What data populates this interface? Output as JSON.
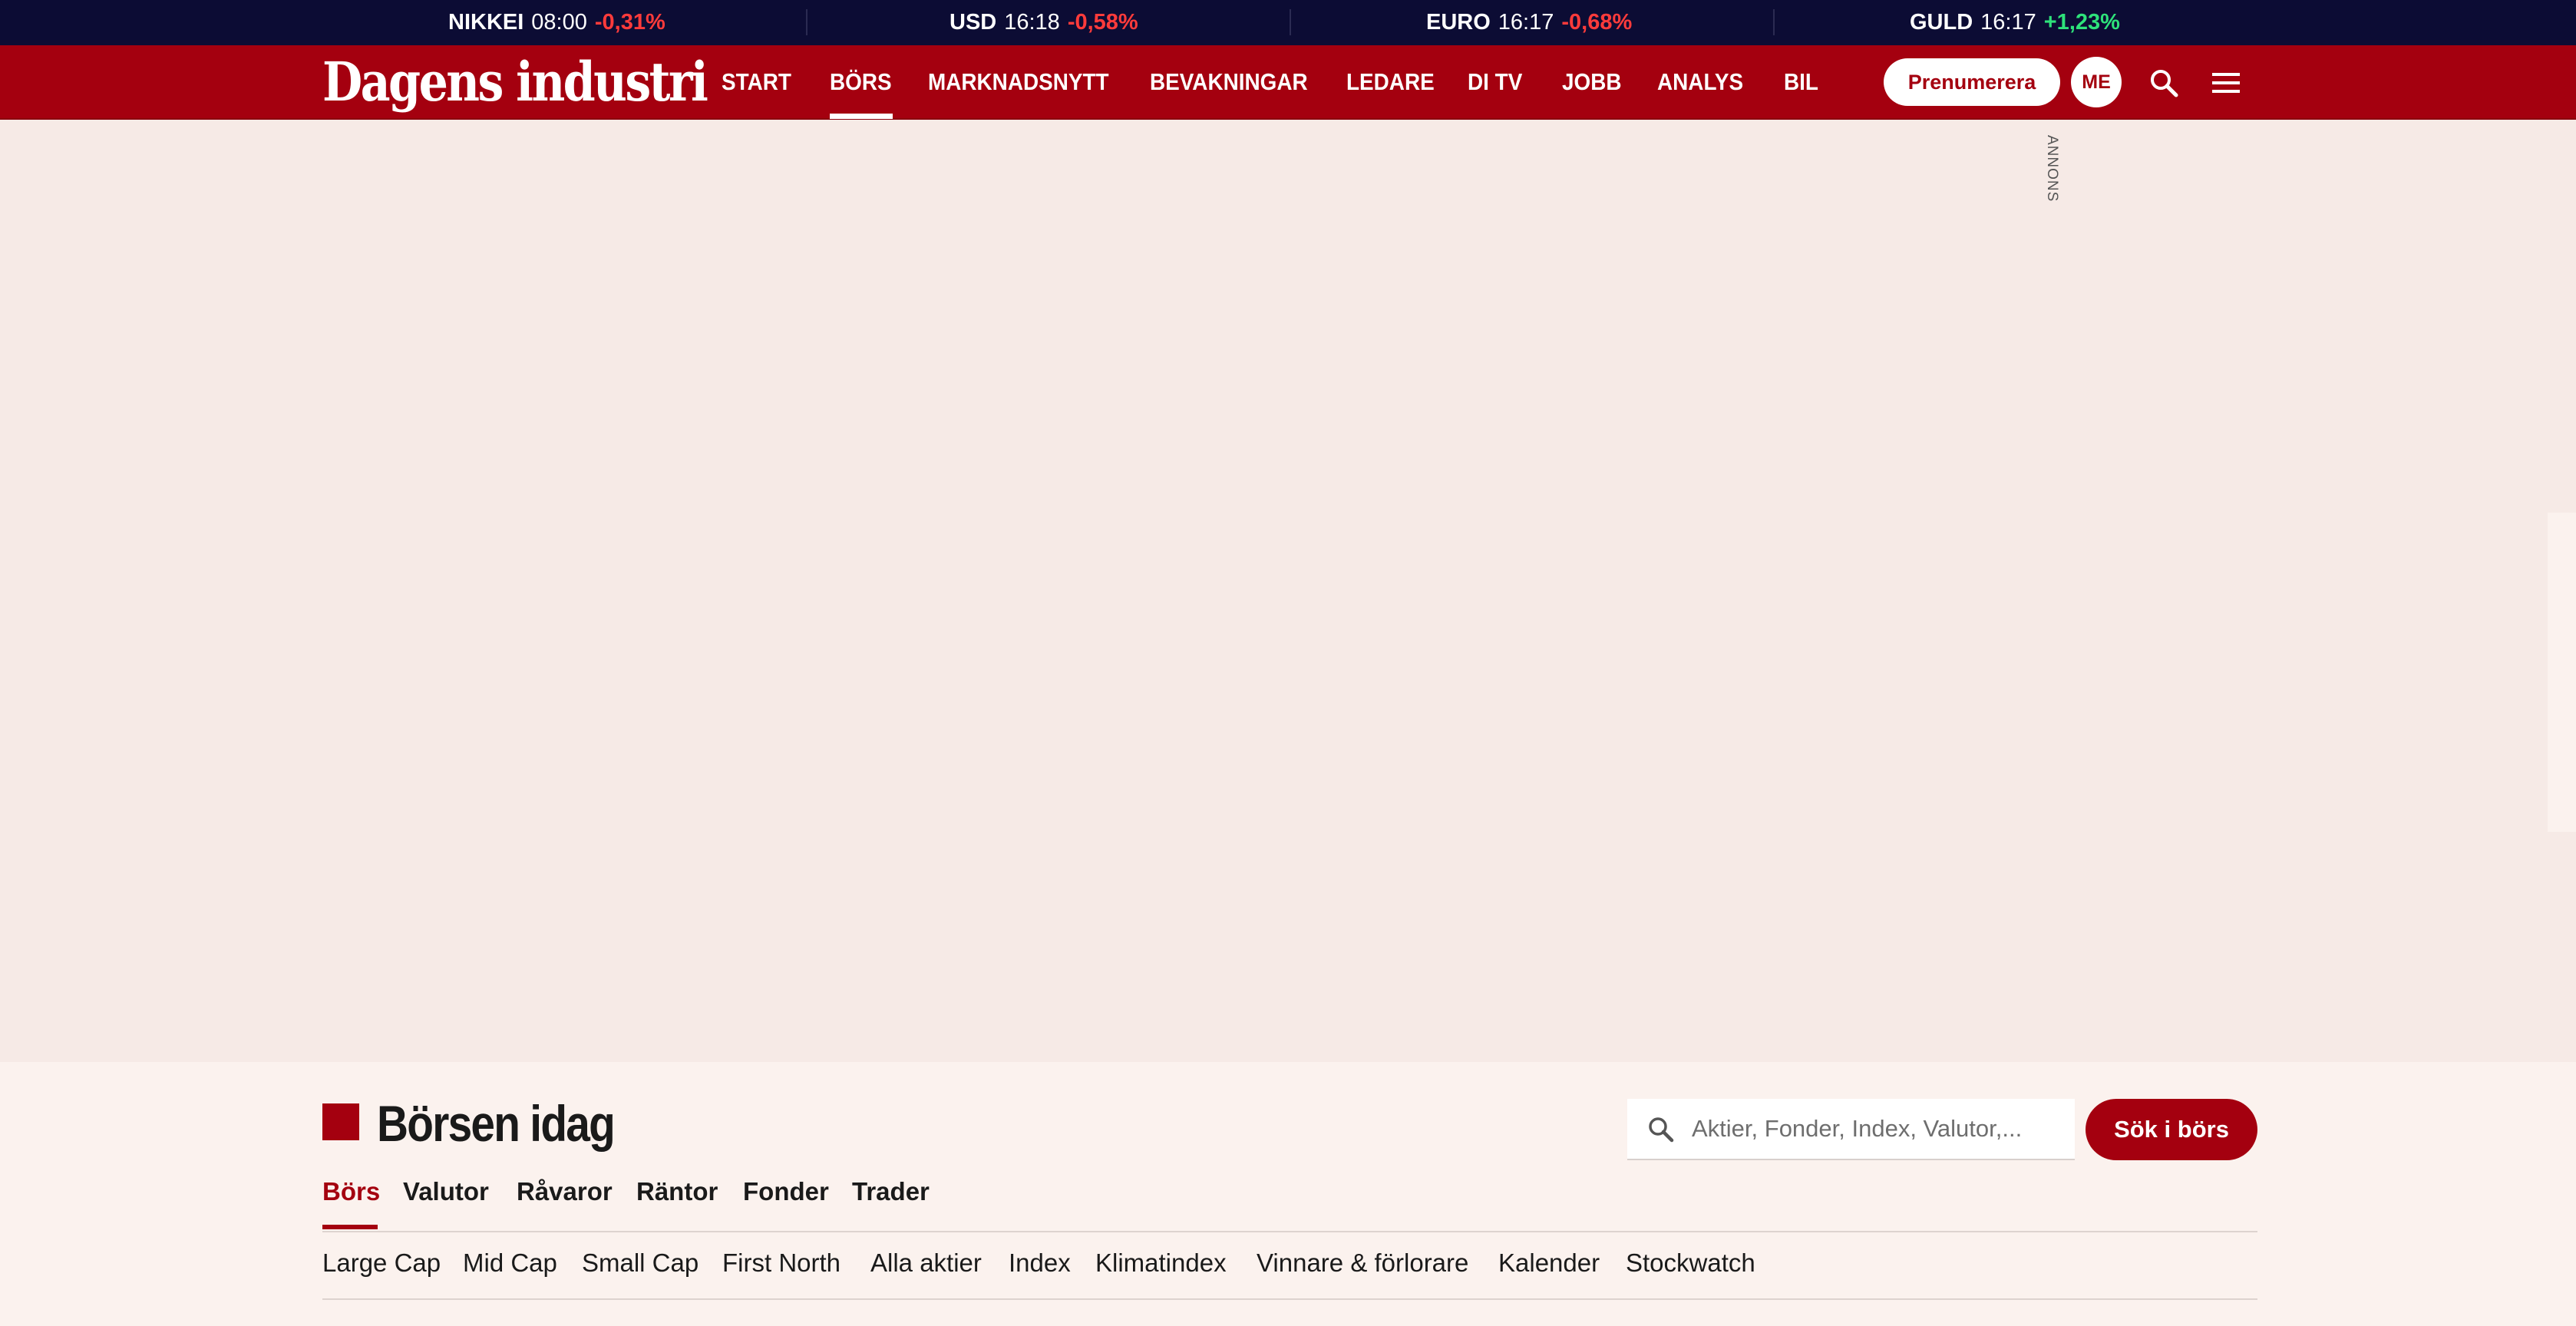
{
  "ticker": [
    {
      "name": "NIKKEI",
      "time": "08:00",
      "change": "-0,31%",
      "direction": "negative"
    },
    {
      "name": "USD",
      "time": "16:18",
      "change": "-0,58%",
      "direction": "negative"
    },
    {
      "name": "EURO",
      "time": "16:17",
      "change": "-0,68%",
      "direction": "negative"
    },
    {
      "name": "GULD",
      "time": "16:17",
      "change": "+1,23%",
      "direction": "positive"
    }
  ],
  "header": {
    "logo": "Dagens industri",
    "nav": [
      "START",
      "BÖRS",
      "MARKNADSNYTT",
      "BEVAKNINGAR",
      "LEDARE",
      "DI TV",
      "JOBB",
      "ANALYS",
      "BIL"
    ],
    "active_nav": "BÖRS",
    "subscribe_label": "Prenumerera",
    "avatar_initials": "ME",
    "search_icon": "search-icon",
    "menu_icon": "hamburger-menu-icon"
  },
  "ad": {
    "label": "ANNONS"
  },
  "section": {
    "title": "Börsen idag",
    "search_placeholder": "Aktier, Fonder, Index, Valutor,...",
    "search_button": "Sök i börs",
    "tabs": [
      "Börs",
      "Valutor",
      "Råvaror",
      "Räntor",
      "Fonder",
      "Trader"
    ],
    "active_tab": "Börs",
    "sublinks": [
      "Large Cap",
      "Mid Cap",
      "Small Cap",
      "First North",
      "Alla aktier",
      "Index",
      "Klimatindex",
      "Vinnare & förlorare",
      "Kalender",
      "Stockwatch"
    ]
  },
  "colors": {
    "brand_red": "#a4000f",
    "ticker_bg": "#0c0c34",
    "negative": "#ff3b3b",
    "positive": "#2ee27a",
    "page_bg": "#fbf2ee",
    "ad_bg": "#f6eae6"
  }
}
